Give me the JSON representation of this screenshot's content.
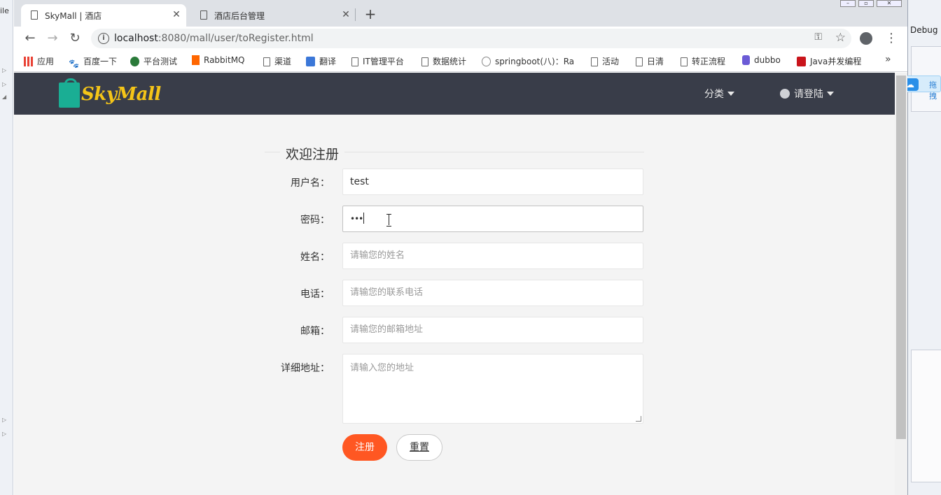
{
  "browser": {
    "tabs": [
      {
        "title": "SkyMall | 酒店",
        "active": true
      },
      {
        "title": "酒店后台管理",
        "active": false
      }
    ],
    "url_host": "localhost",
    "url_rest": ":8080/mall/user/toRegister.html",
    "bookmarks": [
      {
        "label": "应用",
        "icon": "apps-grid-icon"
      },
      {
        "label": "百度一下",
        "icon": "baidu-paw-icon"
      },
      {
        "label": "平台测试",
        "icon": "globe-icon"
      },
      {
        "label": "RabbitMQ",
        "icon": "rabbitmq-icon"
      },
      {
        "label": "渠道",
        "icon": "page-icon"
      },
      {
        "label": "翻译",
        "icon": "translate-icon"
      },
      {
        "label": "IT管理平台",
        "icon": "page-icon"
      },
      {
        "label": "数据统计",
        "icon": "page-icon"
      },
      {
        "label": "springboot(八)：Ra",
        "icon": "globe-icon"
      },
      {
        "label": "活动",
        "icon": "page-icon"
      },
      {
        "label": "日清",
        "icon": "page-icon"
      },
      {
        "label": "转正流程",
        "icon": "page-icon"
      },
      {
        "label": "dubbo",
        "icon": "dubbo-icon"
      },
      {
        "label": "Java并发编程",
        "icon": "csdn-icon"
      }
    ]
  },
  "ide": {
    "left_fragment": "ile",
    "right_label": "Debug",
    "baidu_tip": "拖拽"
  },
  "site": {
    "logo_text": "SkyMall",
    "nav_category": "分类",
    "nav_login": "请登陆",
    "accent": "#ff5722",
    "navbar_color": "#393d49"
  },
  "form": {
    "title": "欢迎注册",
    "fields": [
      {
        "label": "用户名：",
        "value": "test",
        "placeholder": ""
      },
      {
        "label": "密码：",
        "value": "•••",
        "placeholder": ""
      },
      {
        "label": "姓名：",
        "value": "",
        "placeholder": "请输您的姓名"
      },
      {
        "label": "电话：",
        "value": "",
        "placeholder": "请输您的联系电话"
      },
      {
        "label": "邮箱：",
        "value": "",
        "placeholder": "请输您的邮箱地址"
      }
    ],
    "address": {
      "label": "详细地址：",
      "placeholder": "请输入您的地址"
    },
    "submit_label": "注册",
    "reset_label": "重置"
  }
}
